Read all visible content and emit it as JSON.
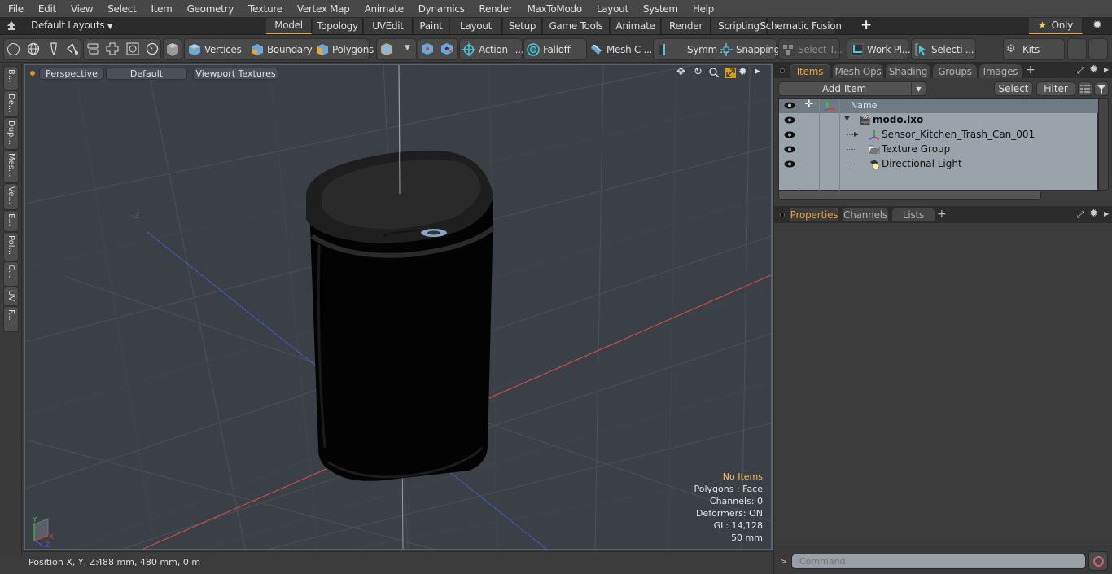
{
  "menu": [
    "File",
    "Edit",
    "View",
    "Select",
    "Item",
    "Geometry",
    "Texture",
    "Vertex Map",
    "Animate",
    "Dynamics",
    "Render",
    "MaxToModo",
    "Layout",
    "System",
    "Help"
  ],
  "layouts_label": "Default Layouts",
  "layout_tabs": [
    {
      "label": "Model",
      "active": true
    },
    {
      "label": "Topology"
    },
    {
      "label": "UVEdit"
    },
    {
      "label": "Paint"
    },
    {
      "label": "Layout"
    },
    {
      "label": "Setup"
    },
    {
      "label": "Game Tools"
    },
    {
      "label": "Animate"
    },
    {
      "label": "Render"
    },
    {
      "label": "Scripting"
    },
    {
      "label": "Schematic Fusion"
    }
  ],
  "only_label": "Only",
  "toolbar": {
    "vertices": "Vertices",
    "boundary": "Boundary",
    "polygons": "Polygons",
    "action": "Action",
    "action_more": "...",
    "falloff": "Falloff",
    "mesh": "Mesh C ...",
    "symmetry": "Symm ...",
    "snapping": "Snapping",
    "select_t": "Select T...",
    "work_plane": "Work Pl...",
    "selection": "Selecti ...",
    "kits": "Kits"
  },
  "left_tabs": [
    "B...",
    "De...",
    "Dup...",
    "Mes...",
    "Ve...",
    "E...",
    "Pol...",
    "C...",
    "UV",
    "F..."
  ],
  "viewport": {
    "view": "Perspective",
    "shading": "Default",
    "textures": "Viewport Textures",
    "axis_label": "-Z",
    "hud": {
      "items": "No Items",
      "polygons": "Polygons : Face",
      "channels": "Channels: 0",
      "deformers": "Deformers: ON",
      "gl": "GL: 14,128",
      "scale": "50 mm"
    },
    "gizmo": {
      "x": "X",
      "y": "Y",
      "z": "Z"
    }
  },
  "status": {
    "position_label": "Position X, Y, Z:",
    "position_value": "488 mm, 480 mm, 0 m"
  },
  "panel": {
    "tabs": [
      {
        "label": "Items",
        "active": true
      },
      {
        "label": "Mesh Ops"
      },
      {
        "label": "Shading"
      },
      {
        "label": "Groups"
      },
      {
        "label": "Images"
      }
    ],
    "add_item": "Add Item",
    "select": "Select",
    "filter": "Filter",
    "name_header": "Name",
    "items": [
      {
        "name": "modo.lxo",
        "bold": true
      },
      {
        "name": "Sensor_Kitchen_Trash_Can_001"
      },
      {
        "name": "Texture Group"
      },
      {
        "name": "Directional Light"
      }
    ],
    "lower_tabs": [
      {
        "label": "Properties",
        "active": true
      },
      {
        "label": "Channels"
      },
      {
        "label": "Lists"
      }
    ]
  },
  "command": {
    "prompt": ">",
    "placeholder": "Command"
  },
  "colors": {
    "accent": "#e8a33d",
    "hud_highlight": "#f0c060",
    "x_axis": "#c84040",
    "y_axis": "#40b040",
    "z_axis": "#4060d0"
  }
}
